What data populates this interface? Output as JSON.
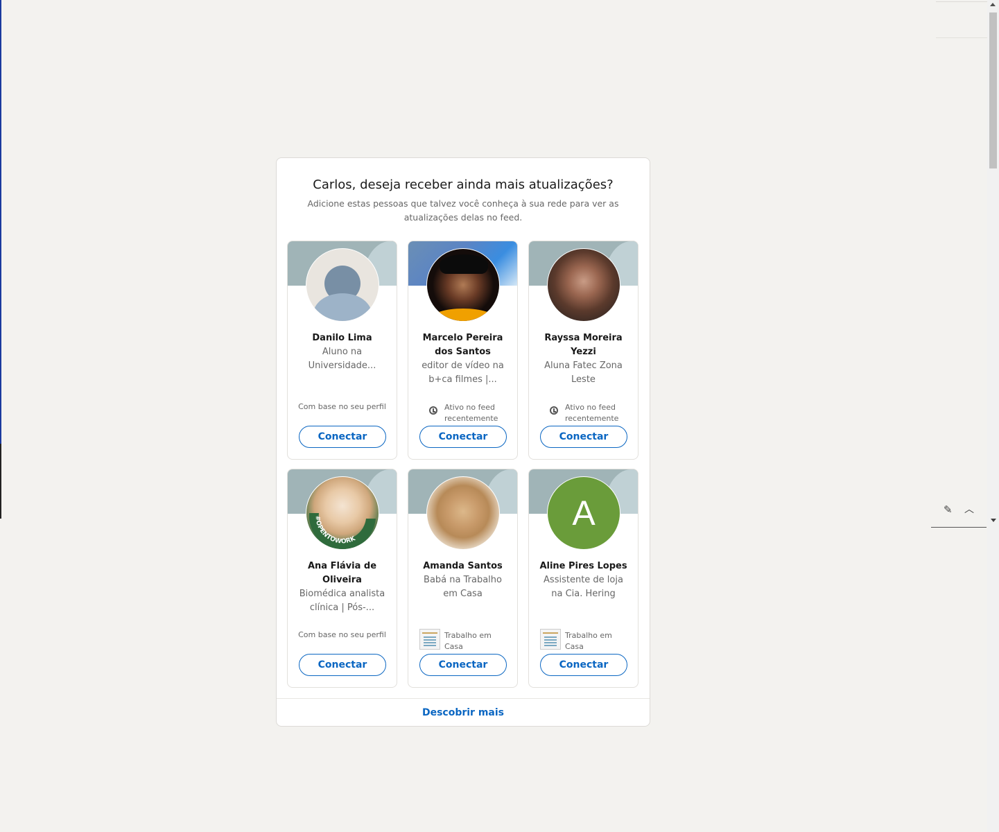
{
  "panel": {
    "title": "Carlos, deseja receber ainda mais atualizações?",
    "subtitle": "Adicione estas pessoas que talvez você conheça à sua rede para ver as atualizações delas no feed.",
    "discover_label": "Descobrir mais"
  },
  "cards": [
    {
      "name": "Danilo Lima",
      "headline": "Aluno na Universidade...",
      "reason": "Com base no seu perfil",
      "connect": "Conectar"
    },
    {
      "name": "Marcelo Pereira dos Santos",
      "headline": "editor de vídeo na b+ca filmes |...",
      "reason": "Ativo no feed recentemente",
      "connect": "Conectar"
    },
    {
      "name": "Rayssa Moreira Yezzi",
      "headline": "Aluna Fatec Zona Leste",
      "reason": "Ativo no feed recentemente",
      "connect": "Conectar"
    },
    {
      "name": "Ana Flávia de Oliveira",
      "headline": "Biomédica analista clínica | Pós-...",
      "reason": "Com base no seu perfil",
      "connect": "Conectar",
      "badge": "#OPENTOWORK"
    },
    {
      "name": "Amanda Santos",
      "headline": "Babá na Trabalho em Casa",
      "reason": "Trabalho em Casa",
      "connect": "Conectar"
    },
    {
      "name": "Aline Pires Lopes",
      "headline": "Assistente de loja na Cia. Hering",
      "reason": "Trabalho em Casa",
      "connect": "Conectar",
      "avatar_letter": "A"
    }
  ],
  "colors": {
    "accent": "#0a66c2",
    "background": "#f3f2ef"
  },
  "icons": {
    "messaging_compose": "compose-icon",
    "messaging_collapse": "chevron-up-icon"
  }
}
